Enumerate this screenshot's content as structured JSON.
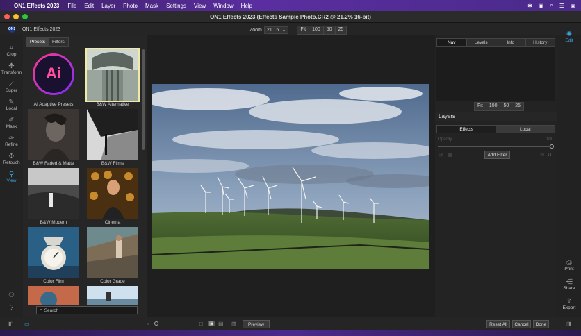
{
  "menubar": {
    "app": "ON1 Effects 2023",
    "items": [
      "File",
      "Edit",
      "Layer",
      "Photo",
      "Mask",
      "Settings",
      "View",
      "Window",
      "Help"
    ]
  },
  "window": {
    "title": "ON1 Effects 2023 (Effects Sample Photo.CR2 @ 21.2% 16-bit)"
  },
  "toolbar": {
    "brand": "ON1 Effects 2023",
    "zoom_label": "Zoom",
    "zoom_value": "21.16",
    "zoom_buttons": [
      "Fit",
      "100",
      "50",
      "25"
    ]
  },
  "left_tools": [
    "Crop",
    "Transform",
    "Super",
    "Local",
    "Mask",
    "Refine",
    "Retouch",
    "View"
  ],
  "active_tool": "View",
  "presets_panel": {
    "tabs": [
      "Presets",
      "Filters"
    ],
    "active_tab": "Presets",
    "tiles": [
      "AI Adaptive Presets",
      "B&W Alternative",
      "B&W Faded & Matte",
      "B&W Films",
      "B&W Modern",
      "Cinema",
      "Color Film",
      "Color Grade"
    ],
    "ai_badge": "Ai",
    "search_placeholder": "Search"
  },
  "right_panel": {
    "nav_tabs": [
      "Nav",
      "Levels",
      "Info",
      "History"
    ],
    "active_nav_tab": "Nav",
    "nav_zoom_buttons": [
      "Fit",
      "100",
      "50",
      "25"
    ],
    "layers_title": "Layers",
    "layer_tabs": [
      "Effects",
      "Local"
    ],
    "active_layer_tab": "Effects",
    "opacity_label": "Opacity",
    "opacity_value": "100",
    "opacity_level": 1.0,
    "add_filter": "Add Filter"
  },
  "right_tools": {
    "edit": "Edit",
    "print": "Print",
    "share": "Share",
    "export": "Export"
  },
  "bottom": {
    "preview": "Preview",
    "reset_all": "Reset All",
    "cancel": "Cancel",
    "done": "Done"
  },
  "colors": {
    "accent": "#3aa7e0",
    "selected_outline": "#f1e9a8"
  }
}
